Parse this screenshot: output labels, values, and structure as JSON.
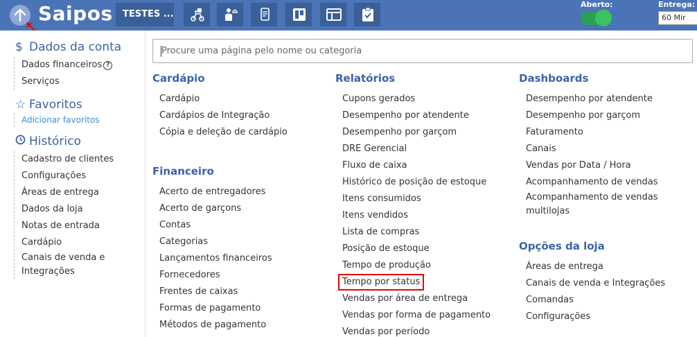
{
  "header": {
    "logo": "Saipos",
    "store": "TESTES ...",
    "aberto_label": "Aberto:",
    "entrega_label": "Entrega:",
    "entrega_value": "60 Mir",
    "tool_icons": [
      "delivery-icon",
      "waiter-icon",
      "tablet-icon",
      "kanban-icon",
      "table-icon",
      "checklist-icon"
    ],
    "accent": "#4b74b6"
  },
  "sidebar": {
    "account": {
      "title": "Dados da conta",
      "items": [
        "Dados financeiros",
        "Serviços"
      ]
    },
    "favorites": {
      "title": "Favoritos",
      "add_link": "Adicionar favoritos"
    },
    "history": {
      "title": "Histórico",
      "items": [
        "Cadastro de clientes",
        "Configurações",
        "Áreas de entrega",
        "Dados da loja",
        "Notas de entrada",
        "Cardápio",
        "Canais de venda e Integrações"
      ]
    }
  },
  "search": {
    "placeholder": "Procure uma página pelo nome ou categoria"
  },
  "columns": {
    "cardapio": {
      "title": "Cardápio",
      "items": [
        "Cardápio",
        "Cardápios de Integração",
        "Cópia e deleção de cardápio"
      ]
    },
    "financeiro": {
      "title": "Financeiro",
      "items": [
        "Acerto de entregadores",
        "Acerto de garçons",
        "Contas",
        "Categorias",
        "Lançamentos financeiros",
        "Fornecedores",
        "Frentes de caixas",
        "Formas de pagamento",
        "Métodos de pagamento"
      ]
    },
    "relatorios": {
      "title": "Relatórios",
      "items": [
        "Cupons gerados",
        "Desempenho por atendente",
        "Desempenho por garçom",
        "DRE Gerencial",
        "Fluxo de caixa",
        "Histórico de posição de estoque",
        "Itens consumidos",
        "Itens vendidos",
        "Lista de compras",
        "Posição de estoque",
        "Tempo de produção",
        "Tempo por status",
        "Vendas por área de entrega",
        "Vendas por forma de pagamento",
        "Vendas por período"
      ]
    },
    "dashboards": {
      "title": "Dashboards",
      "items": [
        "Desempenho por atendente",
        "Desempenho por garçom",
        "Faturamento",
        "Canais",
        "Vendas por Data / Hora",
        "Acompanhamento de vendas",
        "Acompanhamento de vendas multilojas"
      ]
    },
    "opcoes": {
      "title": "Opções da loja",
      "items": [
        "Áreas de entrega",
        "Canais de venda e Integrações",
        "Comandas",
        "Configurações"
      ]
    }
  }
}
